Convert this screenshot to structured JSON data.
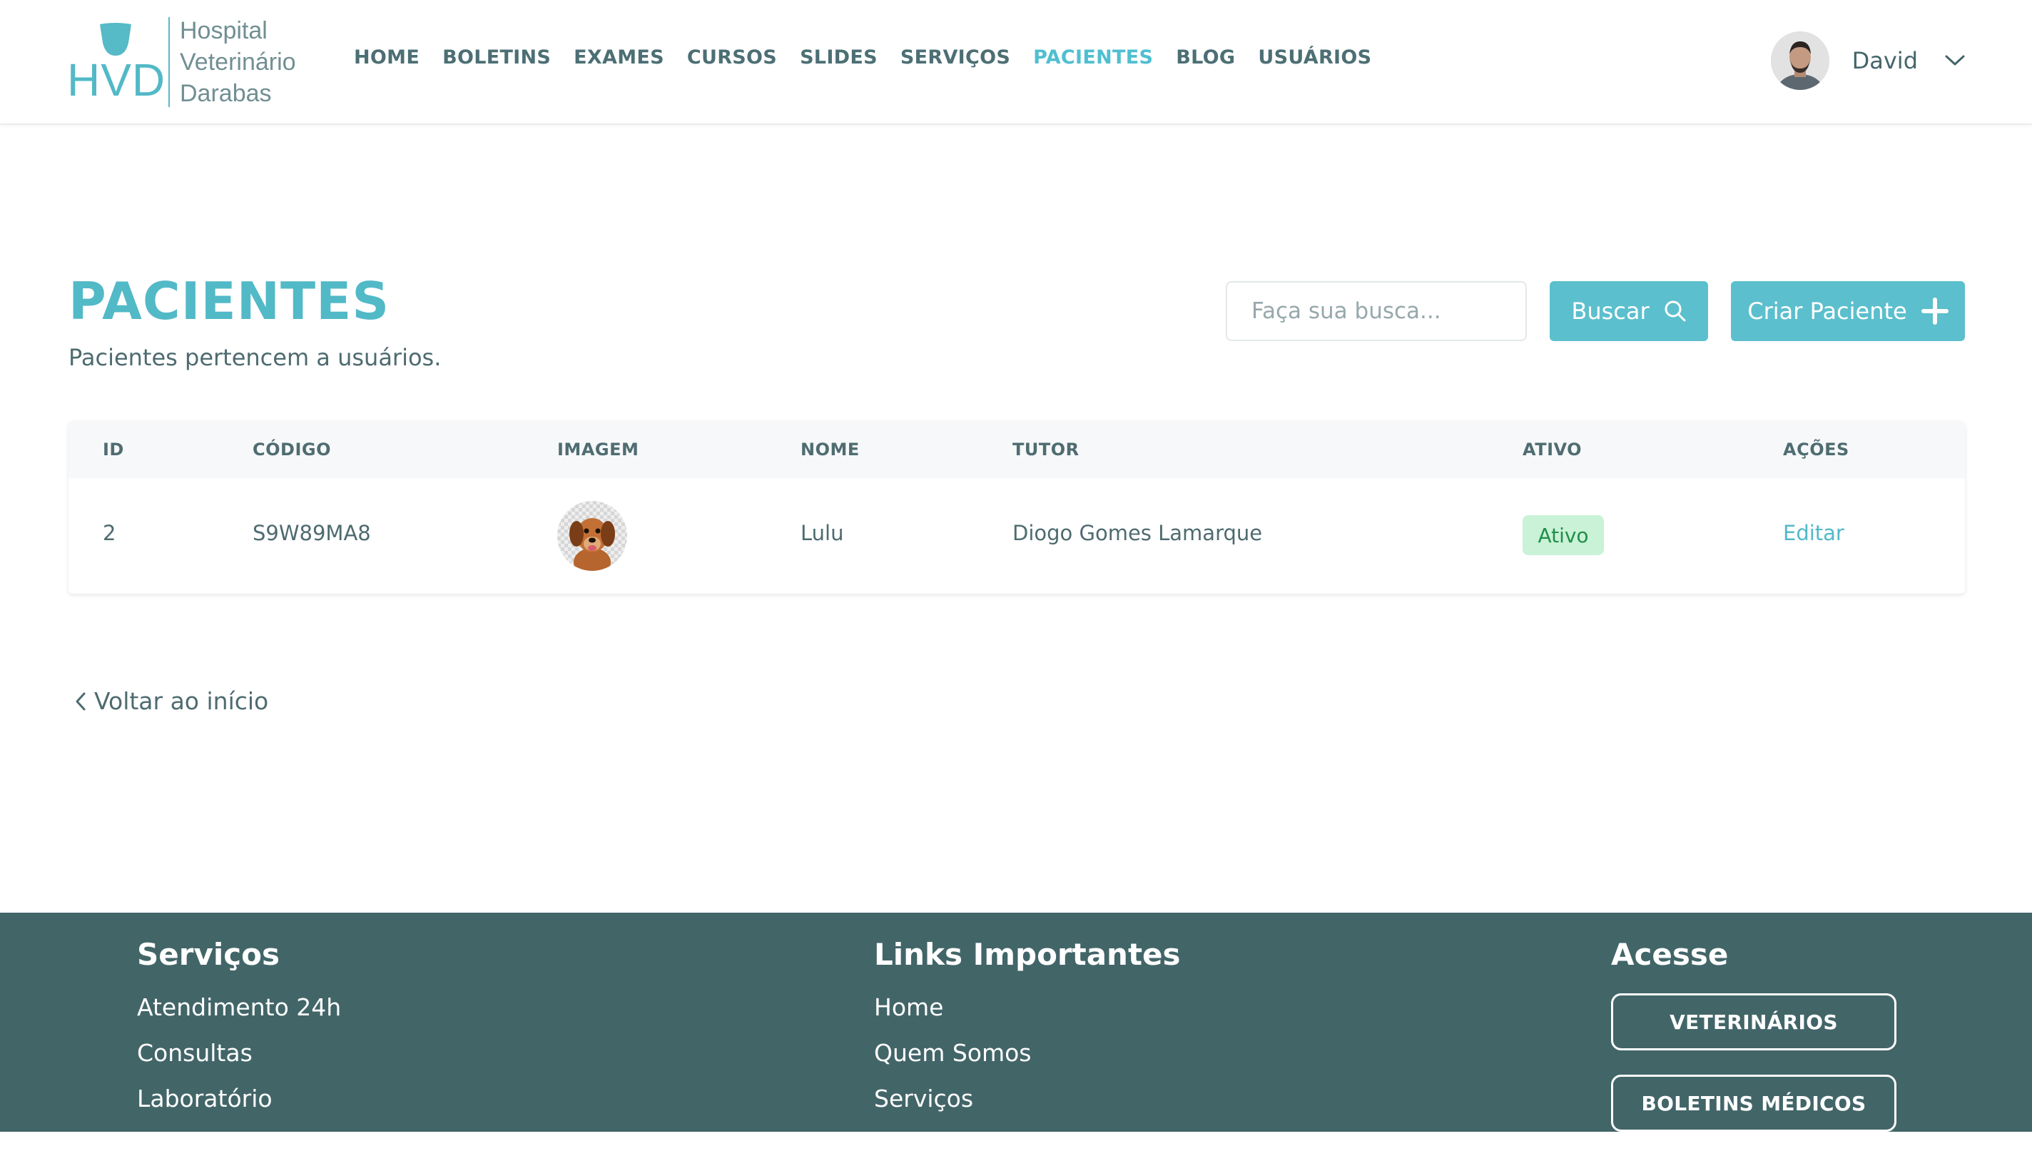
{
  "header": {
    "logo": {
      "abbr": "HVD",
      "line1": "Hospital",
      "line2": "Veterinário",
      "line3": "Darabas"
    },
    "nav": [
      {
        "label": "HOME",
        "active": false
      },
      {
        "label": "BOLETINS",
        "active": false
      },
      {
        "label": "EXAMES",
        "active": false
      },
      {
        "label": "CURSOS",
        "active": false
      },
      {
        "label": "SLIDES",
        "active": false
      },
      {
        "label": "SERVIÇOS",
        "active": false
      },
      {
        "label": "PACIENTES",
        "active": true
      },
      {
        "label": "BLOG",
        "active": false
      },
      {
        "label": "USUÁRIOS",
        "active": false
      }
    ],
    "user": {
      "name": "David",
      "icon": "chevron-down-icon"
    }
  },
  "main": {
    "title": "PACIENTES",
    "subtitle": "Pacientes pertencem a usuários.",
    "search": {
      "placeholder": "Faça sua busca...",
      "value": ""
    },
    "search_button": {
      "label": "Buscar",
      "icon": "search-icon"
    },
    "create_button": {
      "label": "Criar Paciente",
      "icon": "plus-icon"
    },
    "table": {
      "columns": [
        "ID",
        "CÓDIGO",
        "IMAGEM",
        "NOME",
        "TUTOR",
        "ATIVO",
        "AÇÕES"
      ],
      "rows": [
        {
          "id": "2",
          "code": "S9W89MA8",
          "image": "dog-photo",
          "name": "Lulu",
          "tutor": "Diogo Gomes Lamarque",
          "status": "Ativo",
          "action": "Editar"
        }
      ]
    },
    "back_link": {
      "label": "Voltar ao início",
      "icon": "chevron-left-icon"
    }
  },
  "footer": {
    "services": {
      "title": "Serviços",
      "links": [
        "Atendimento 24h",
        "Consultas",
        "Laboratório"
      ]
    },
    "important_links": {
      "title": "Links Importantes",
      "links": [
        "Home",
        "Quem Somos",
        "Serviços"
      ]
    },
    "access": {
      "title": "Acesse",
      "buttons": [
        "VETERINÁRIOS",
        "BOLETINS MÉDICOS"
      ]
    }
  },
  "colors": {
    "accent": "#52b9c7",
    "button": "#5cbfcd",
    "nav_text": "#4c6f74",
    "footer_bg": "#426568",
    "badge_bg": "#c9f2d6",
    "badge_text": "#1f8f49"
  }
}
